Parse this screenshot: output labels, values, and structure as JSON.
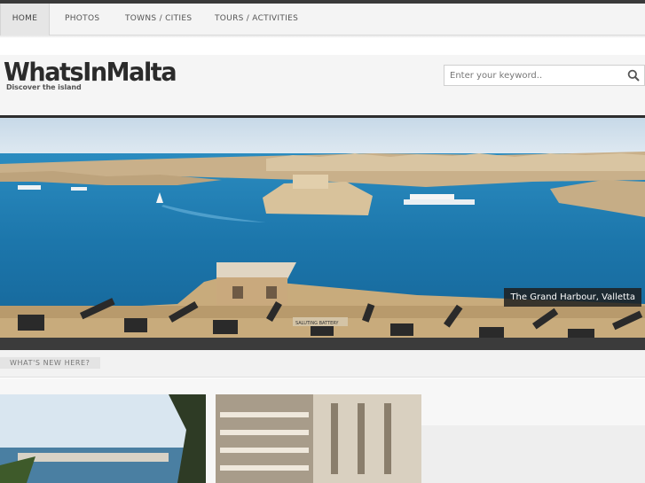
{
  "nav": {
    "items": [
      {
        "label": "HOME",
        "active": true
      },
      {
        "label": "PHOTOS",
        "active": false
      },
      {
        "label": "TOWNS / CITIES",
        "active": false
      },
      {
        "label": "TOURS / ACTIVITIES",
        "active": false
      }
    ]
  },
  "brand": {
    "logo": "WhatsInMalta",
    "tagline": "Discover the island"
  },
  "search": {
    "placeholder": "Enter your keyword.."
  },
  "hero": {
    "caption": "The Grand Harbour, Valletta",
    "sign_text": "SALUTING BATTERY"
  },
  "section": {
    "title": "WHAT'S NEW HERE?"
  },
  "colors": {
    "sea": "#1f7fb3",
    "sky": "#cfe0ee",
    "stone": "#c9ad82"
  }
}
